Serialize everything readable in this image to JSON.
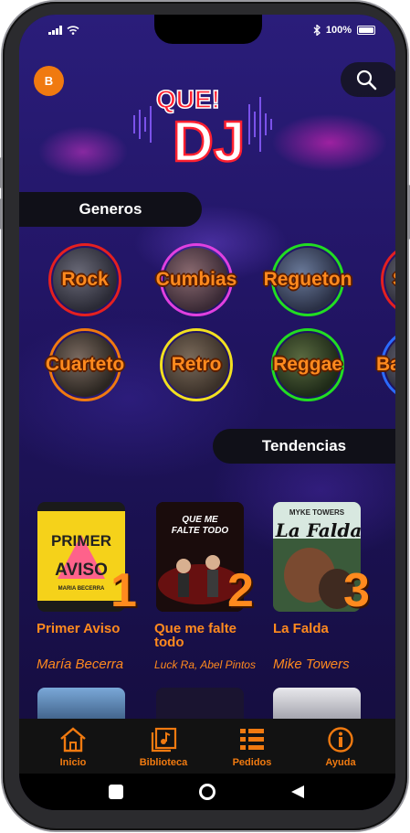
{
  "status": {
    "battery": "100%"
  },
  "header": {
    "avatar_letter": "B",
    "search_icon": "search-icon",
    "logo_top": "QUE!",
    "logo_main": "DJ"
  },
  "sections": {
    "genres_title": "Generos",
    "trending_title": "Tendencias"
  },
  "genres": [
    {
      "label": "Rock",
      "ring": "#e52020"
    },
    {
      "label": "Cumbias",
      "ring": "#e040e0"
    },
    {
      "label": "Regueton",
      "ring": "#22dd22"
    },
    {
      "label": "S",
      "ring": "#e52020"
    },
    {
      "label": "Cuarteto",
      "ring": "#f07a10"
    },
    {
      "label": "Retro",
      "ring": "#f2e020"
    },
    {
      "label": "Reggae",
      "ring": "#22dd22"
    },
    {
      "label": "Ba",
      "ring": "#2b6bff"
    }
  ],
  "trending": [
    {
      "rank": "1",
      "title": "Primer Aviso",
      "artist": "María Becerra"
    },
    {
      "rank": "2",
      "title": "Que me falte todo",
      "artist": "Luck Ra, Abel Pintos"
    },
    {
      "rank": "3",
      "title": "La Falda",
      "artist": "Mike Towers"
    }
  ],
  "covers": {
    "c1_top": "PRIMER",
    "c1_bottom": "AVISO",
    "c1_artist": "MARIA BECERRA",
    "c2_top": "QUE ME",
    "c2_bottom": "FALTE TODO",
    "c3_artist": "MYKE TOWERS",
    "c3_title": "La Falda"
  },
  "bottom_nav": [
    {
      "label": "Inicio",
      "icon": "home-icon"
    },
    {
      "label": "Biblioteca",
      "icon": "library-icon"
    },
    {
      "label": "Pedidos",
      "icon": "list-icon"
    },
    {
      "label": "Ayuda",
      "icon": "info-icon"
    }
  ],
  "colors": {
    "accent": "#f07a10",
    "nav_bg": "#121212",
    "background": "#1a1150"
  }
}
